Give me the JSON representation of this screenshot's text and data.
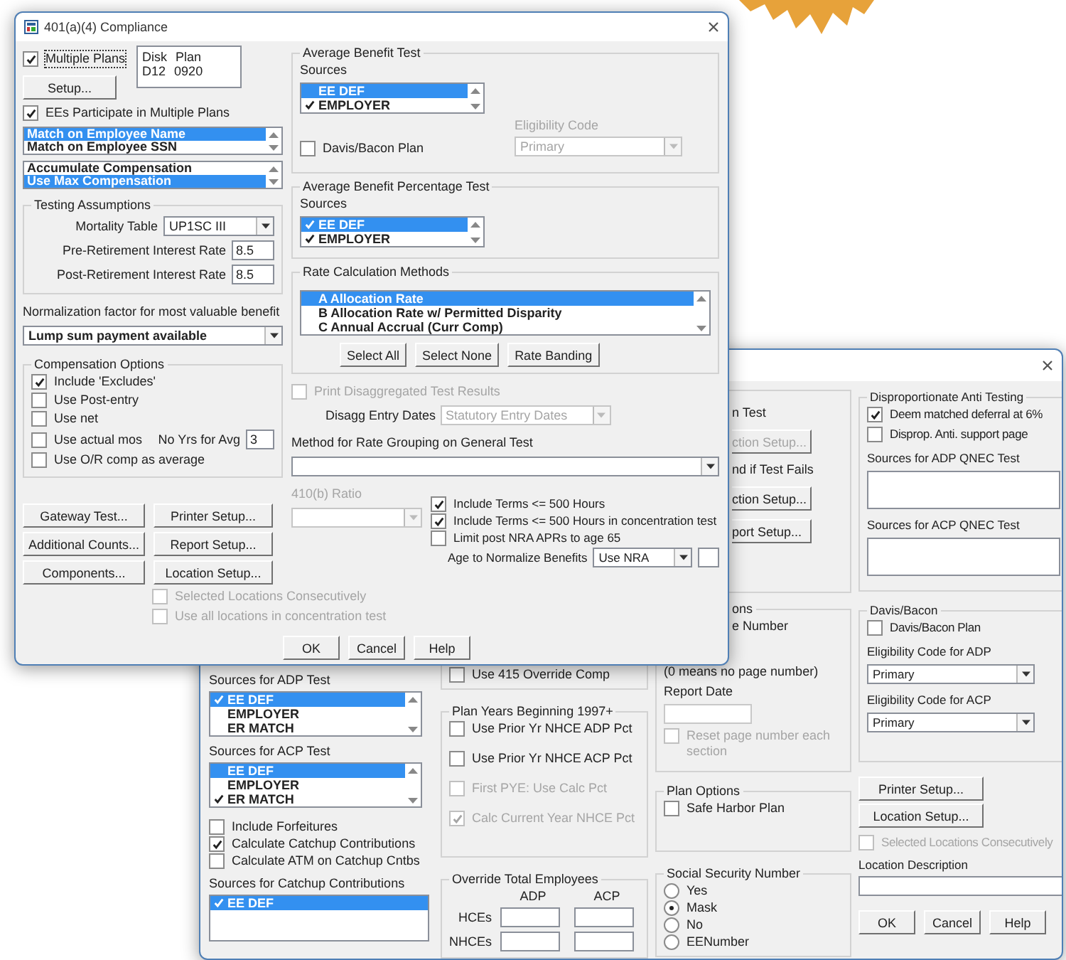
{
  "front_window": {
    "title": "401(a)(4) Compliance",
    "multiple_plans": {
      "label": "Multiple Plans",
      "checked": true,
      "disabled": false
    },
    "plan_list": [
      {
        "disk": "Disk",
        "plan": "Plan"
      },
      {
        "disk": "D12",
        "plan": "0920"
      }
    ],
    "setup_button": "Setup...",
    "ees_participate": {
      "label": "EEs Participate in Multiple Plans",
      "checked": true,
      "disabled": false
    },
    "match_list": [
      {
        "label": "Match on Employee Name",
        "selected": true
      },
      {
        "label": "Match on Employee SSN",
        "selected": false
      }
    ],
    "compensation_list": [
      {
        "label": "Accumulate Compensation",
        "selected": false
      },
      {
        "label": "Use Max Compensation",
        "selected": true
      }
    ],
    "testing_assumptions": {
      "title": "Testing Assumptions",
      "fields": [
        {
          "kind": "select",
          "label": "Mortality Table",
          "value": "UP1SC III"
        },
        {
          "kind": "input",
          "label": "Pre-Retirement Interest Rate",
          "value": "8.5"
        },
        {
          "kind": "input",
          "label": "Post-Retirement Interest Rate",
          "value": "8.5"
        }
      ]
    },
    "normalization": {
      "label": "Normalization factor for most valuable benefit",
      "value": "Lump sum payment available"
    },
    "compensation_options": {
      "title": "Compensation Options",
      "options": [
        {
          "label": "Include 'Excludes'",
          "checked": true
        },
        {
          "label": "Use Post-entry",
          "checked": false
        },
        {
          "label": "Use net",
          "checked": false
        },
        {
          "label": "Use actual mos",
          "checked": false,
          "field_label": "No Yrs for Avg",
          "field_value": "3"
        },
        {
          "label": "Use O/R comp as average",
          "checked": false
        }
      ]
    },
    "command_buttons": [
      "Gateway Test...",
      "Printer Setup...",
      "Additional Counts...",
      "Report Setup...",
      "Components...",
      "Location Setup..."
    ],
    "location_options": [
      {
        "label": "Selected Locations Consecutively",
        "checked": false,
        "disabled": true
      },
      {
        "label": "Use all locations in concentration test",
        "checked": false,
        "disabled": true
      }
    ],
    "average_benefit_test": {
      "title": "Average Benefit Test",
      "sources_label": "Sources",
      "sources": [
        {
          "label": "EE DEF",
          "checked": false,
          "selected": true
        },
        {
          "label": "EMPLOYER",
          "checked": true,
          "selected": false
        }
      ],
      "davis_bacon": {
        "label": "Davis/Bacon Plan",
        "checked": false,
        "disabled": false
      },
      "eligibility": {
        "label": "Eligibility Code",
        "value": "Primary",
        "disabled": true
      }
    },
    "average_benefit_percentage_test": {
      "title": "Average Benefit Percentage Test",
      "sources_label": "Sources",
      "sources": [
        {
          "label": "EE DEF",
          "checked": true,
          "selected": true
        },
        {
          "label": "EMPLOYER",
          "checked": true,
          "selected": false
        }
      ]
    },
    "rate_calculation_methods": {
      "title": "Rate Calculation Methods",
      "methods": [
        {
          "label": "A Allocation Rate",
          "checked": false,
          "selected": true
        },
        {
          "label": "B Allocation Rate w/ Permitted Disparity",
          "checked": false,
          "selected": false
        },
        {
          "label": "C Annual Accrual (Curr Comp)",
          "checked": false,
          "selected": false
        }
      ],
      "buttons": [
        "Select All",
        "Select None",
        "Rate Banding"
      ]
    },
    "print_disaggregated": {
      "label": "Print Disaggregated Test Results",
      "checked": false,
      "disabled": true
    },
    "disagg_entry_dates": {
      "label": "Disagg Entry Dates",
      "value": "Statutory Entry Dates",
      "disabled": true
    },
    "rate_grouping": {
      "label": "Method for Rate Grouping on General Test"
    },
    "ratio_410b": {
      "label": "410(b) Ratio",
      "disabled": true
    },
    "term_options": [
      {
        "label": "Include Terms <= 500 Hours",
        "checked": true,
        "disabled": false
      },
      {
        "label": "Include Terms <= 500 Hours in concentration test",
        "checked": true,
        "disabled": false
      },
      {
        "label": "Limit post NRA APRs to age 65",
        "checked": false,
        "disabled": false
      }
    ],
    "age_to_normalize": {
      "label": "Age to Normalize Benefits",
      "value": "Use NRA"
    },
    "dialog_buttons": [
      "OK",
      "Cancel",
      "Help"
    ]
  },
  "back_window": {
    "adp_sources": {
      "label": "Sources for ADP Test",
      "items": [
        {
          "label": "EE DEF",
          "checked": true,
          "selected": true
        },
        {
          "label": "EMPLOYER",
          "checked": false,
          "selected": false
        },
        {
          "label": "ER MATCH",
          "checked": false,
          "selected": false
        }
      ]
    },
    "acp_sources": {
      "label": "Sources for ACP Test",
      "items": [
        {
          "label": "EE DEF",
          "checked": false,
          "selected": true
        },
        {
          "label": "EMPLOYER",
          "checked": false,
          "selected": false
        },
        {
          "label": "ER MATCH",
          "checked": true,
          "selected": false
        }
      ]
    },
    "catchup_options": [
      {
        "label": "Include Forfeitures",
        "checked": false,
        "disabled": false
      },
      {
        "label": "Calculate Catchup Contributions",
        "checked": true,
        "disabled": false
      },
      {
        "label": "Calculate ATM on Catchup Cntbs",
        "checked": false,
        "disabled": false
      }
    ],
    "catchup_sources": {
      "label": "Sources for Catchup Contributions",
      "items": [
        {
          "label": "EE DEF",
          "checked": true,
          "selected": true
        }
      ]
    },
    "override_comp": {
      "label": "Use 415 Override Comp",
      "checked": false,
      "disabled": false
    },
    "plan_years": {
      "title": "Plan Years Beginning 1997+",
      "options": [
        {
          "label": "Use Prior Yr NHCE ADP Pct",
          "checked": false,
          "disabled": false
        },
        {
          "label": "Use Prior Yr NHCE ACP Pct",
          "checked": false,
          "disabled": false
        },
        {
          "label": "First PYE: Use Calc Pct",
          "checked": false,
          "disabled": true
        },
        {
          "label": "Calc Current Year NHCE Pct",
          "checked": true,
          "disabled": true
        }
      ]
    },
    "override_employees": {
      "title": "Override Total Employees",
      "columns": [
        "ADP",
        "ACP"
      ],
      "rows": [
        "HCEs",
        "NHCEs"
      ]
    },
    "test_setup": {
      "items": [
        {
          "kind": "fragment",
          "text": "n Test"
        },
        {
          "kind": "button",
          "label": "ction Setup...",
          "disabled": true
        },
        {
          "kind": "fragment",
          "text": "nd if Test Fails"
        },
        {
          "kind": "button",
          "label": "ction Setup...",
          "disabled": false
        },
        {
          "kind": "button",
          "label": "port Setup...",
          "disabled": false
        }
      ]
    },
    "report_options": {
      "title": "ons",
      "items": [
        {
          "kind": "fragment",
          "text": "e Number"
        },
        {
          "kind": "text",
          "text": "(0 means no page number)"
        },
        {
          "kind": "text",
          "text": "Report Date"
        },
        {
          "kind": "input"
        },
        {
          "kind": "checkbox",
          "label": "Reset page number each section",
          "checked": false,
          "disabled": true
        }
      ]
    },
    "plan_options": {
      "title": "Plan Options",
      "options": [
        {
          "label": "Safe Harbor Plan",
          "checked": false,
          "disabled": false
        }
      ]
    },
    "social_security_number": {
      "title": "Social Security Number",
      "choices": [
        {
          "label": "Yes",
          "selected": false
        },
        {
          "label": "Mask",
          "selected": true
        },
        {
          "label": "No",
          "selected": false
        },
        {
          "label": "EENumber",
          "selected": false
        }
      ]
    },
    "disproportionate": {
      "title": "Disproportionate Anti Testing",
      "options": [
        {
          "label": "Deem matched deferral at 6%",
          "checked": true,
          "disabled": false
        },
        {
          "label": "Disprop. Anti. support page",
          "checked": false,
          "disabled": false
        }
      ],
      "lists": [
        "Sources for ADP QNEC Test",
        "Sources for ACP QNEC Test"
      ]
    },
    "davis_bacon": {
      "title": "Davis/Bacon",
      "plan": {
        "label": "Davis/Bacon Plan",
        "checked": false,
        "disabled": false
      },
      "codes": [
        {
          "label": "Eligibility Code for ADP",
          "value": "Primary"
        },
        {
          "label": "Eligibility Code for ACP",
          "value": "Primary"
        }
      ]
    },
    "setup_buttons": [
      "Printer Setup...",
      "Location Setup..."
    ],
    "selected_locations": {
      "label": "Selected Locations Consecutively",
      "checked": false,
      "disabled": true
    },
    "location_description": {
      "label": "Location Description"
    },
    "dialog_buttons": [
      "OK",
      "Cancel",
      "Help"
    ]
  }
}
